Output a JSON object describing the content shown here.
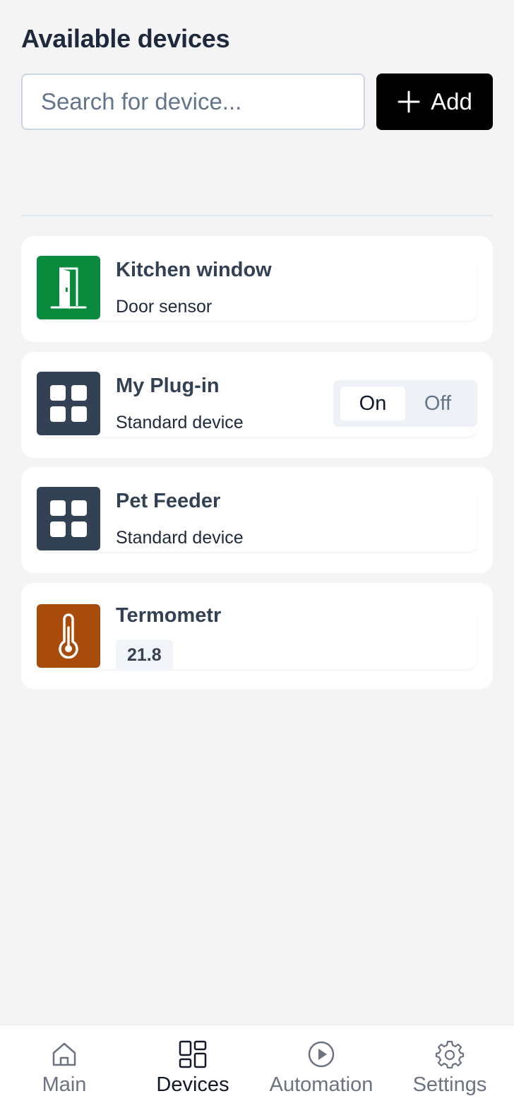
{
  "header": {
    "title": "Available devices"
  },
  "search": {
    "placeholder": "Search for device...",
    "value": ""
  },
  "toolbar": {
    "add_label": "Add",
    "add_icon": "plus-icon"
  },
  "devices": [
    {
      "name": "Kitchen window",
      "type": "Door sensor",
      "icon": "door-icon",
      "icon_color": "#0a8a3c"
    },
    {
      "name": "My Plug-in",
      "type": "Standard device",
      "icon": "grid-icon",
      "icon_color": "#334155",
      "toggle": {
        "on_label": "On",
        "off_label": "Off",
        "selected": "On"
      }
    },
    {
      "name": "Pet Feeder",
      "type": "Standard device",
      "icon": "grid-icon",
      "icon_color": "#334155"
    },
    {
      "name": "Termometr",
      "value": "21.8",
      "icon": "thermometer-icon",
      "icon_color": "#a84c0c"
    }
  ],
  "nav": {
    "items": [
      {
        "label": "Main",
        "icon": "home-icon",
        "active": false
      },
      {
        "label": "Devices",
        "icon": "devices-icon",
        "active": true
      },
      {
        "label": "Automation",
        "icon": "play-circle-icon",
        "active": false
      },
      {
        "label": "Settings",
        "icon": "gear-icon",
        "active": false
      }
    ]
  }
}
